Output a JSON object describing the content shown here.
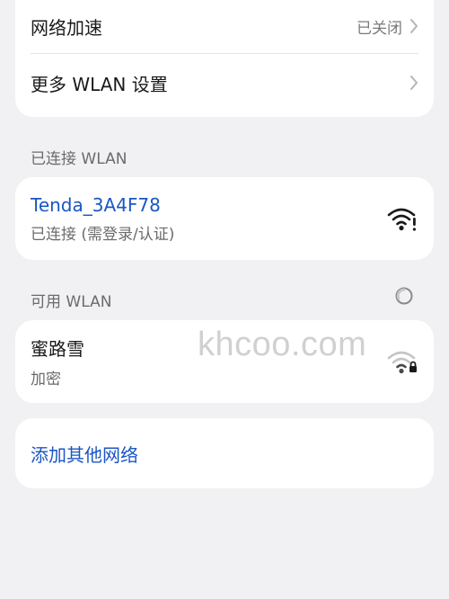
{
  "settings": {
    "network_accel": {
      "label": "网络加速",
      "value": "已关闭"
    },
    "more_wlan": {
      "label": "更多 WLAN 设置"
    }
  },
  "connected_section": {
    "label": "已连接 WLAN",
    "network": {
      "ssid": "Tenda_3A4F78",
      "status": "已连接 (需登录/认证)",
      "icon": "wifi-warning-icon"
    }
  },
  "available_section": {
    "label": "可用 WLAN",
    "networks": [
      {
        "ssid": "蜜路雪",
        "security": "加密",
        "icon": "wifi-lock-icon"
      }
    ]
  },
  "add_network": {
    "label": "添加其他网络"
  },
  "watermark": "khcoo.com",
  "colors": {
    "accent": "#1a56c4",
    "background": "#f1f1f3",
    "card": "#ffffff"
  }
}
